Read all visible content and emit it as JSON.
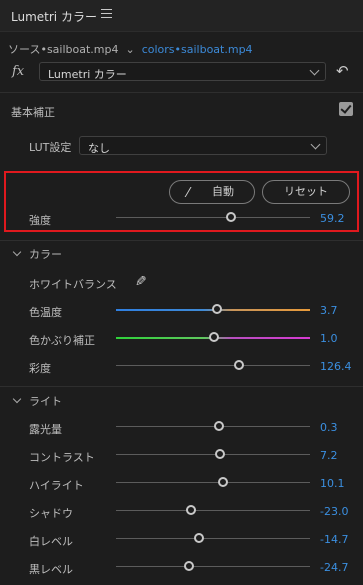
{
  "titlebar": {
    "title": "Lumetri カラー"
  },
  "source": {
    "clip": "ソース•sailboat.mp4",
    "separator": "⌄",
    "sequence": "colors•sailboat.mp4"
  },
  "effect": {
    "fx_label": "fx",
    "selected": "Lumetri カラー"
  },
  "basic": {
    "title": "基本補正",
    "enabled": true,
    "lut_label": "LUT設定",
    "lut_value": "なし",
    "auto_label": "自動",
    "reset_label": "リセット",
    "intensity": {
      "label": "強度",
      "value": "59.2",
      "min": 0,
      "max": 100,
      "number": 59.2
    }
  },
  "color": {
    "title": "カラー",
    "white_balance": "ホワイトバランス",
    "temperature": {
      "label": "色温度",
      "value": "3.7",
      "min": -100,
      "max": 100,
      "number": 3.7
    },
    "tint": {
      "label": "色かぶり補正",
      "value": "1.0",
      "min": -100,
      "max": 100,
      "number": 1.0
    },
    "saturation": {
      "label": "彩度",
      "value": "126.4",
      "min": 0,
      "max": 200,
      "number": 126.4
    }
  },
  "light": {
    "title": "ライト",
    "sliders": [
      {
        "label": "露光量",
        "value": "0.3",
        "min": -5,
        "max": 5,
        "number": 0.3
      },
      {
        "label": "コントラスト",
        "value": "7.2",
        "min": -100,
        "max": 100,
        "number": 7.2
      },
      {
        "label": "ハイライト",
        "value": "10.1",
        "min": -100,
        "max": 100,
        "number": 10.1
      },
      {
        "label": "シャドウ",
        "value": "-23.0",
        "min": -100,
        "max": 100,
        "number": -23.0
      },
      {
        "label": "白レベル",
        "value": "-14.7",
        "min": -100,
        "max": 100,
        "number": -14.7
      },
      {
        "label": "黒レベル",
        "value": "-24.7",
        "min": -100,
        "max": 100,
        "number": -24.7
      }
    ]
  },
  "colors": {
    "accent": "#3b8fe0",
    "highlight_border": "#e0191e",
    "temperature_left": "#2f7fe0",
    "temperature_right": "#e89a3a",
    "tint_left": "#2fd23a",
    "tint_right": "#d63ad2"
  }
}
